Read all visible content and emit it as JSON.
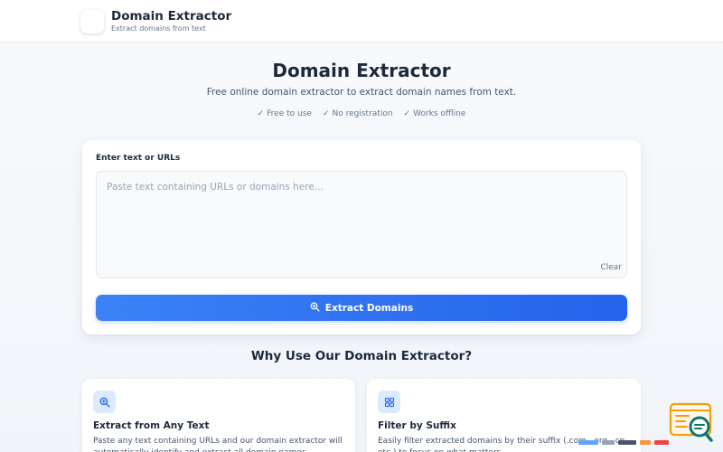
{
  "header": {
    "title": "Domain Extractor",
    "subtitle": "Extract domains from text"
  },
  "hero": {
    "title": "Domain Extractor",
    "subtitle": "Free online domain extractor to extract domain names from text.",
    "badges": [
      "Free to use",
      "No registration",
      "Works offline"
    ]
  },
  "input_card": {
    "label": "Enter text or URLs",
    "value": "",
    "placeholder": "Paste text containing URLs or domains here...",
    "clear_label": "Clear",
    "extract_label": "Extract Domains",
    "extract_icon": "search-icon"
  },
  "features": {
    "title": "Why Use Our Domain Extractor?",
    "items": [
      {
        "icon": "search-icon",
        "title": "Extract from Any Text",
        "description": "Paste any text containing URLs and our domain extractor will automatically identify and extract all domain names."
      },
      {
        "icon": "grid-icon",
        "title": "Filter by Suffix",
        "description": "Easily filter extracted domains by their suffix (.com, .org, .cn, etc.) to focus on what matters."
      }
    ]
  },
  "colors": {
    "accent": "#2563eb",
    "accent_light": "#3b82f6",
    "text": "#1e293b",
    "muted": "#64748b",
    "icon_bg": "#dbeafe",
    "widget_orange": "#f59e0b",
    "widget_teal": "#0f766e"
  }
}
